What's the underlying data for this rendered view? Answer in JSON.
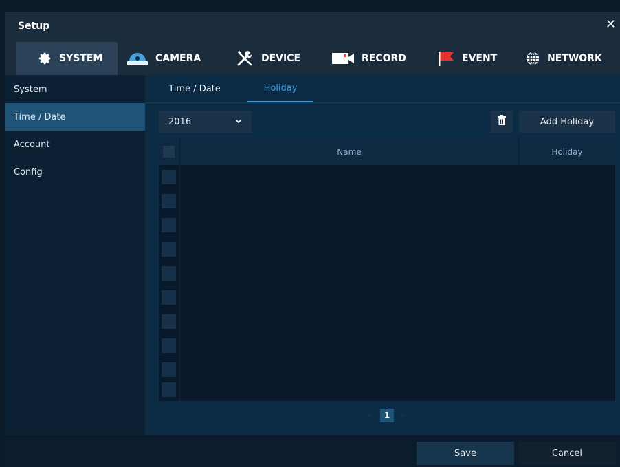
{
  "window": {
    "title": "Setup",
    "close_glyph": "✕"
  },
  "top_tabs": [
    {
      "label": "SYSTEM",
      "icon": "gear-icon",
      "active": true
    },
    {
      "label": "CAMERA",
      "icon": "camera-dome-icon",
      "active": false
    },
    {
      "label": "DEVICE",
      "icon": "tools-icon",
      "active": false
    },
    {
      "label": "RECORD",
      "icon": "video-record-icon",
      "active": false
    },
    {
      "label": "EVENT",
      "icon": "flag-icon",
      "active": false
    },
    {
      "label": "NETWORK",
      "icon": "globe-icon",
      "active": false
    }
  ],
  "sidebar": {
    "items": [
      {
        "label": "System",
        "active": false
      },
      {
        "label": "Time / Date",
        "active": true
      },
      {
        "label": "Account",
        "active": false
      },
      {
        "label": "Config",
        "active": false
      }
    ]
  },
  "sub_tabs": [
    {
      "label": "Time / Date",
      "active": false
    },
    {
      "label": "Holiday",
      "active": true
    }
  ],
  "controls": {
    "year_value": "2016",
    "add_label": "Add Holiday"
  },
  "table": {
    "columns": [
      "Name",
      "Holiday"
    ],
    "row_count": 10
  },
  "pager": {
    "current": "1",
    "prev": "‹",
    "next": "›"
  },
  "footer": {
    "save_label": "Save",
    "cancel_label": "Cancel"
  },
  "colors": {
    "accent": "#3c9de1",
    "active_side": "#1f5377",
    "event_flag": "#e8302c",
    "camera_dome": "#4aa3df"
  }
}
